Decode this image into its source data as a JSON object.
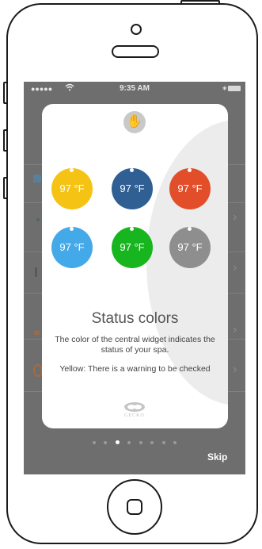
{
  "status_bar": {
    "signal_dots": "●●●●●",
    "wifi_icon": "wifi-icon",
    "time": "9:35 AM",
    "bluetooth": "∗",
    "battery_icon": "battery-icon"
  },
  "card": {
    "top_logo_icon": "gecko-hand-icon",
    "bubbles": [
      {
        "label": "97 °F",
        "color": "#F5C314"
      },
      {
        "label": "97 °F",
        "color": "#2F5F93"
      },
      {
        "label": "97 °F",
        "color": "#E34E2A"
      },
      {
        "label": "97 °F",
        "color": "#44A9E8"
      },
      {
        "label": "97 °F",
        "color": "#17B51E"
      },
      {
        "label": "97 °F",
        "color": "#8E8E8E"
      }
    ],
    "title": "Status colors",
    "description": "The color of the central widget indicates the status of your spa.",
    "note": "Yellow: There is a warning to be checked",
    "brand": "GECKO"
  },
  "pager": {
    "count": 8,
    "active_index": 2
  },
  "skip_label": "Skip"
}
